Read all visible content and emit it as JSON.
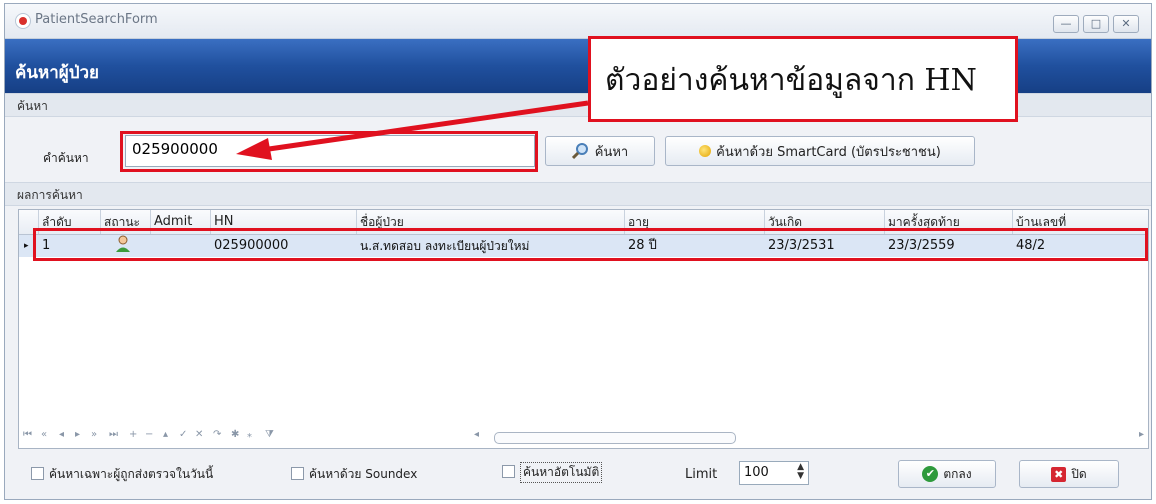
{
  "window": {
    "title": "PatientSearchForm",
    "controls": [
      "—",
      "□",
      "✕"
    ]
  },
  "header": {
    "title": "ค้นหาผู้ป่วย"
  },
  "search_section": {
    "label": "ค้นหา",
    "field_label": "คำค้นหา",
    "query": "025900000",
    "search_button": "ค้นหา",
    "smartcard_button": "ค้นหาด้วย SmartCard (บัตรประชาชน)"
  },
  "results": {
    "label": "ผลการค้นหา",
    "columns": [
      "ลำดับ",
      "สถานะ",
      "Admit",
      "HN",
      "ชื่อผู้ป่วย",
      "อายุ",
      "วันเกิด",
      "มาครั้งสุดท้าย",
      "บ้านเลขที่"
    ],
    "rows": [
      {
        "no": "1",
        "status": "user-icon",
        "admit": "",
        "hn": "025900000",
        "name": "น.ส.ทดสอบ ลงทะเบียนผู้ป่วยใหม่",
        "age": "28 ปี",
        "dob": "23/3/2531",
        "last_visit": "23/3/2559",
        "address": "48/2"
      }
    ],
    "navigator": [
      "⏮",
      "«",
      "◂",
      "▸",
      "»",
      "⏭",
      "+",
      "−",
      "▴",
      "✓",
      "✕",
      "↷",
      "✱",
      "⁎",
      "⧩"
    ]
  },
  "options": {
    "today_only": "ค้นหาเฉพาะผู้ถูกส่งตรวจในวันนี้",
    "soundex": "ค้นหาด้วย Soundex",
    "auto_search": "ค้นหาอัตโนมัติ",
    "limit_label": "Limit",
    "limit_value": "100",
    "ok_button": "ตกลง",
    "close_button": "ปิด"
  },
  "annotation": {
    "text": "ตัวอย่างค้นหาข้อมูลจาก HN"
  },
  "colors": {
    "header": "#1f4fa0",
    "highlight": "#e0111f",
    "selected_row": "#dbe6f5"
  }
}
